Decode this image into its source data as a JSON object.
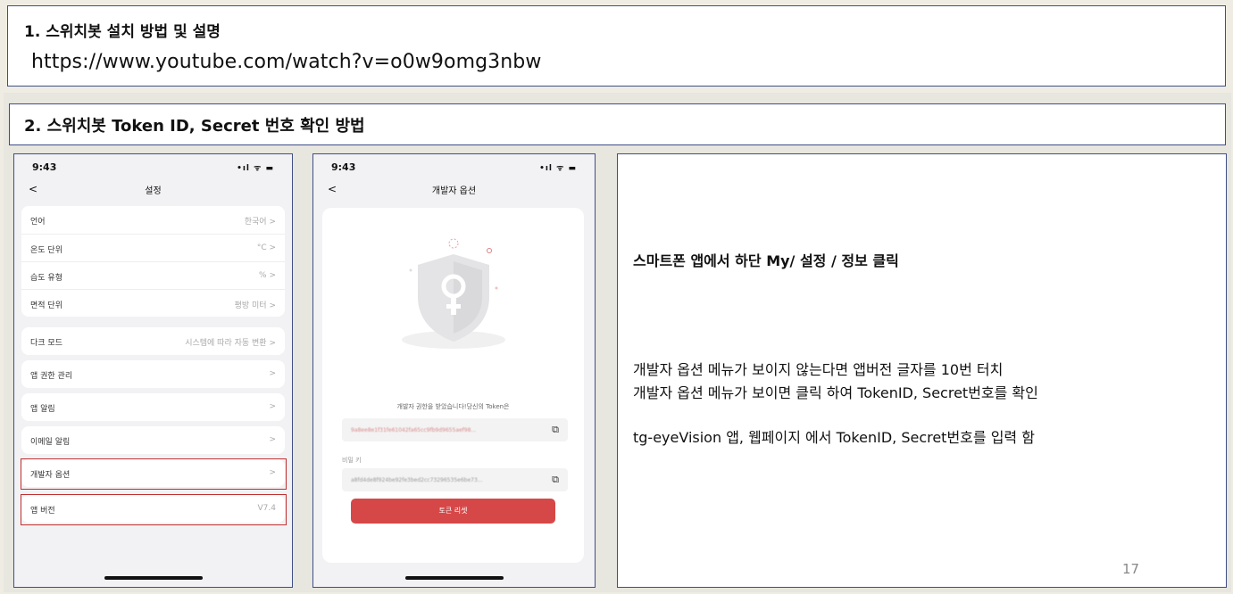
{
  "section1": {
    "title": "1. 스위치봇 설치 방법 및 설명",
    "url": "https://www.youtube.com/watch?v=o0w9omg3nbw"
  },
  "section2": {
    "title": "2. 스위치봇 Token ID, Secret 번호 확인 방법"
  },
  "phone1": {
    "time": "9:43",
    "status_icons": "•ıl ᯤ ▬",
    "back": "<",
    "title": "설정",
    "rows_group1": [
      {
        "label": "언어",
        "value": "한국어 >"
      },
      {
        "label": "온도 단위",
        "value": "°C >"
      },
      {
        "label": "습도 유형",
        "value": "% >"
      },
      {
        "label": "면적 단위",
        "value": "평방 미터 >"
      }
    ],
    "dark_mode": {
      "label": "다크 모드",
      "value": "시스템에 따라 자동 변환 >"
    },
    "app_permission": {
      "label": "앱 권한 관리",
      "value": ">"
    },
    "app_notification": {
      "label": "앱 알림",
      "value": ">"
    },
    "email_notification": {
      "label": "이메일 알림",
      "value": ">"
    },
    "developer_options": {
      "label": "개발자 옵션",
      "value": ">"
    },
    "app_version": {
      "label": "앱 버전",
      "value": "V7.4"
    }
  },
  "phone2": {
    "time": "9:43",
    "status_icons": "•ıl ᯤ ▬",
    "back": "<",
    "title": "개발자 옵션",
    "message": "개발자 권한을 받았습니다!당신의 Token은",
    "token_value": "9a8ee8e1f31fe61042fa65cc9fb9d9655aef98...",
    "secret_label": "비밀 키",
    "secret_value": "a8fd4de8f924be92fe3bed2cc73296535e6be73...",
    "reset_button": "토큰 리셋"
  },
  "description": {
    "line1": "스마트폰 앱에서 하단 My/  설정 / 정보 클릭",
    "line2": "개발자 옵션 메뉴가 보이지 않는다면 앱버전 글자를 10번 터치",
    "line3": "개발자 옵션 메뉴가 보이면 클릭 하여 TokenID, Secret번호를 확인",
    "line4": "tg-eyeVision 앱, 웹페이지 에서 TokenID, Secret번호를 입력 함",
    "page_number": "17"
  },
  "colors": {
    "border": "#3f4f86",
    "highlight": "#c0302f",
    "reset_button": "#d64848"
  }
}
